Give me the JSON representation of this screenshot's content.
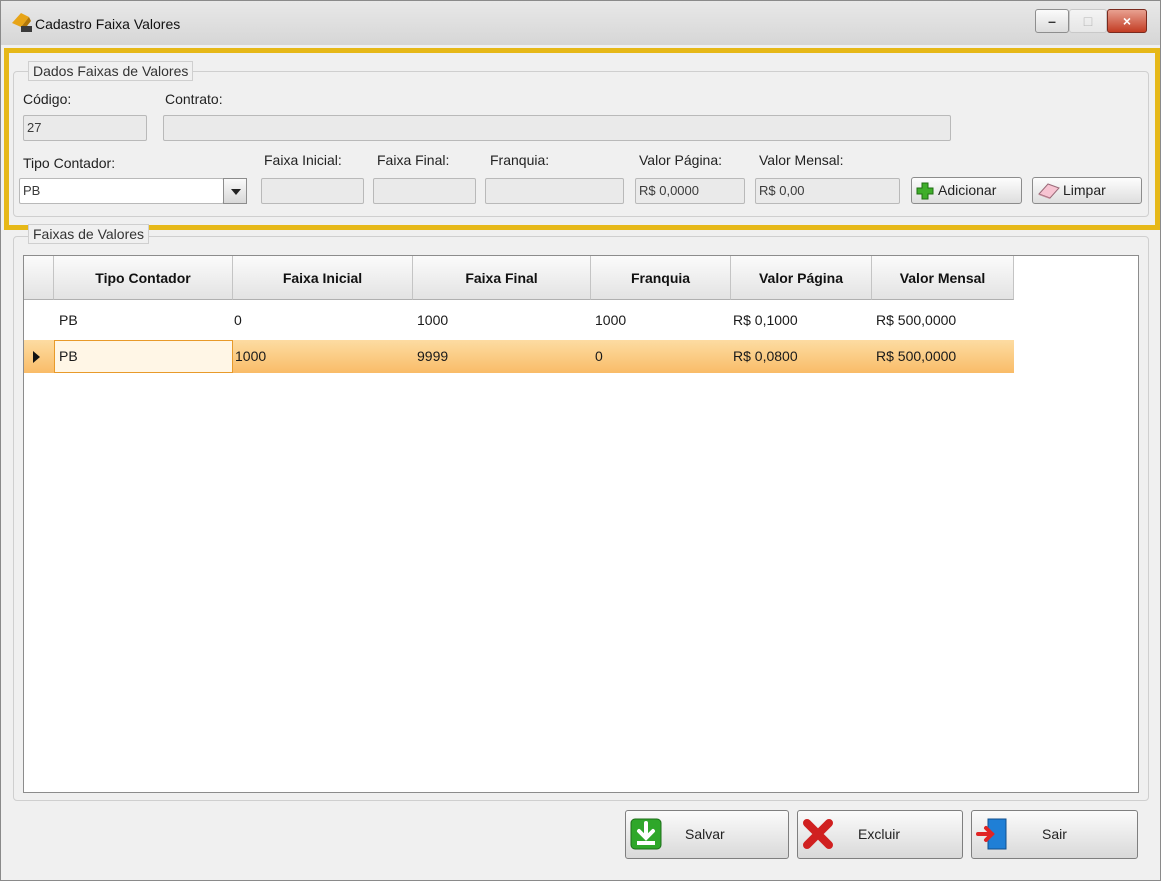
{
  "window": {
    "title": "Cadastro Faixa Valores",
    "minimize": "–",
    "maximize": "□",
    "close": "×"
  },
  "form": {
    "group_title": "Dados Faixas de Valores",
    "codigo": {
      "label": "Código:",
      "value": "27"
    },
    "contrato": {
      "label": "Contrato:",
      "value": ""
    },
    "tipo_contador": {
      "label": "Tipo Contador:",
      "value": "PB"
    },
    "faixa_inicial": {
      "label": "Faixa Inicial:",
      "value": ""
    },
    "faixa_final": {
      "label": "Faixa Final:",
      "value": ""
    },
    "franquia": {
      "label": "Franquia:",
      "value": ""
    },
    "valor_pagina": {
      "label": "Valor Página:",
      "value": "R$ 0,0000"
    },
    "valor_mensal": {
      "label": "Valor Mensal:",
      "value": "R$ 0,00"
    },
    "add_label": "Adicionar",
    "clear_label": "Limpar"
  },
  "grid": {
    "group_title": "Faixas de Valores",
    "columns": [
      "Tipo Contador",
      "Faixa Inicial",
      "Faixa Final",
      "Franquia",
      "Valor Página",
      "Valor Mensal"
    ],
    "rows": [
      [
        "PB",
        "0",
        "1000",
        "1000",
        "R$ 0,1000",
        "R$ 500,0000"
      ],
      [
        "PB",
        "1000",
        "9999",
        "0",
        "R$ 0,0800",
        "R$ 500,0000"
      ]
    ],
    "selected_row": 1
  },
  "actions": {
    "save_label": "Salvar",
    "delete_label": "Excluir",
    "exit_label": "Sair"
  },
  "colors": {
    "highlight": "#e6b818",
    "selected_row": "#f9bc68",
    "add_icon": "#3fae2a",
    "delete_icon": "#d02020",
    "save_icon": "#2fa72a",
    "exit_icon": "#1f7fd6"
  }
}
